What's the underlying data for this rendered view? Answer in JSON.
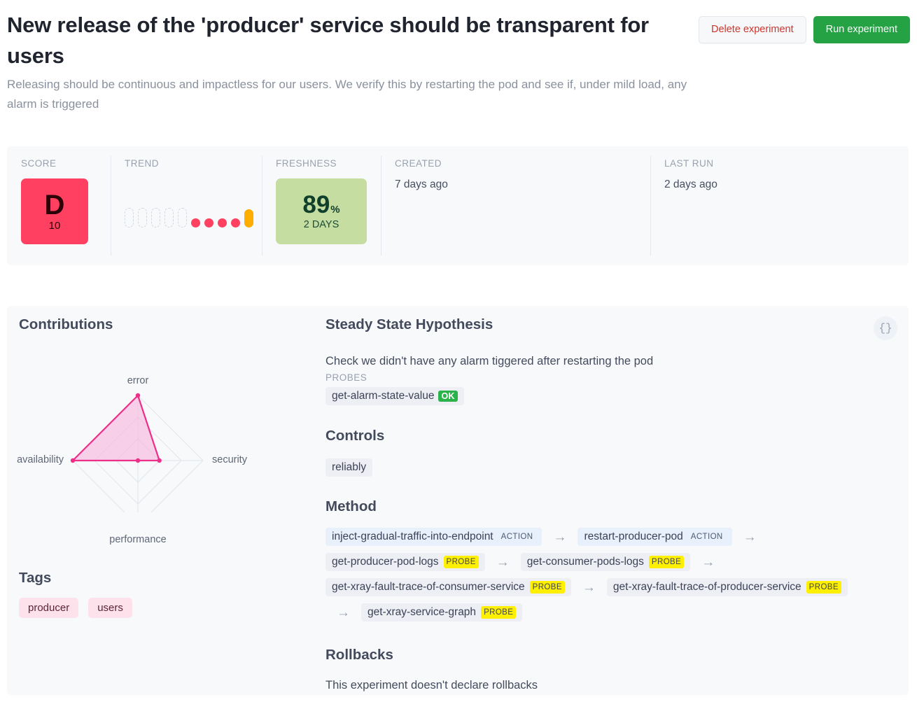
{
  "header": {
    "title": "New release of the 'producer' service should be transparent for users",
    "subtitle": "Releasing should be continuous and impactless for our users. We verify this by restarting the pod and see if, under mild load, any alarm is triggered",
    "delete_button": "Delete experiment",
    "run_button": "Run experiment"
  },
  "stats": {
    "score": {
      "label": "SCORE",
      "grade": "D",
      "value": "10",
      "color": "#ff4060"
    },
    "trend": {
      "label": "TREND",
      "empty_slots": 5,
      "dots": [
        "#ff4060",
        "#ff4060",
        "#ff4060",
        "#ff4060"
      ],
      "last_pill": "#ffae00"
    },
    "freshness": {
      "label": "FRESHNESS",
      "percent": "89",
      "percent_symbol": "%",
      "days": "2 DAYS",
      "color": "#c5dda1"
    },
    "created": {
      "label": "CREATED",
      "value": "7 days ago"
    },
    "last_run": {
      "label": "LAST RUN",
      "value": "2 days ago"
    }
  },
  "contributions": {
    "heading": "Contributions"
  },
  "chart_data": {
    "type": "radar",
    "title": "Contributions",
    "categories": [
      "error",
      "security",
      "performance",
      "availability"
    ],
    "values": [
      1.0,
      0.33,
      0.0,
      1.0
    ],
    "max": 1.0,
    "rings": 3,
    "series": [
      {
        "name": "contributions",
        "values": [
          1.0,
          0.33,
          0.0,
          1.0
        ]
      }
    ],
    "fill_color": "#f7b8dd",
    "line_color": "#ee2f8a",
    "grid_color": "#e2e5ea",
    "legend": "none"
  },
  "tags": {
    "heading": "Tags",
    "items": [
      "producer",
      "users"
    ]
  },
  "steady_state": {
    "heading": "Steady State Hypothesis",
    "description": "Check we didn't have any alarm tiggered after restarting the pod",
    "probes_label": "PROBES",
    "probes": [
      {
        "name": "get-alarm-state-value",
        "status": "OK"
      }
    ],
    "json_button": "{}"
  },
  "controls": {
    "heading": "Controls",
    "items": [
      "reliably"
    ]
  },
  "method": {
    "heading": "Method",
    "steps": [
      {
        "name": "inject-gradual-traffic-into-endpoint",
        "kind": "ACTION"
      },
      {
        "name": "restart-producer-pod",
        "kind": "ACTION"
      },
      {
        "name": "get-producer-pod-logs",
        "kind": "PROBE"
      },
      {
        "name": "get-consumer-pods-logs",
        "kind": "PROBE"
      },
      {
        "name": "get-xray-fault-trace-of-consumer-service",
        "kind": "PROBE"
      },
      {
        "name": "get-xray-fault-trace-of-producer-service",
        "kind": "PROBE"
      },
      {
        "name": "get-xray-service-graph",
        "kind": "PROBE"
      }
    ],
    "arrow": "→"
  },
  "rollbacks": {
    "heading": "Rollbacks",
    "message": "This experiment doesn't declare rollbacks"
  }
}
